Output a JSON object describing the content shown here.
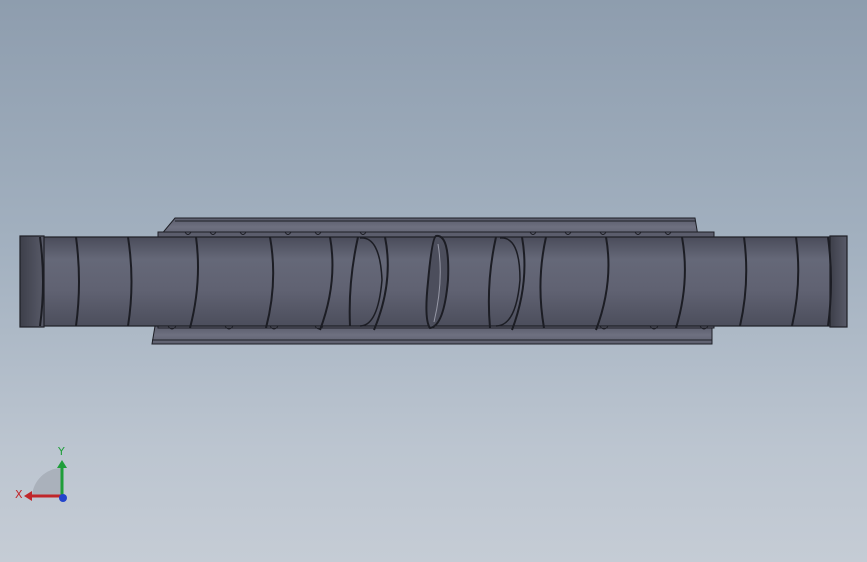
{
  "viewport": {
    "background_top": "#8e9dae",
    "background_bottom": "#c5ccd5"
  },
  "model": {
    "shaft_color": "#5c5e6e",
    "sleeve_color": "#6b6d7d",
    "edge_color": "#1e1f26"
  },
  "triad": {
    "x_label": "X",
    "y_label": "Y",
    "x_color": "#c0262a",
    "y_color": "#1f9e3a",
    "z_color": "#2244cc"
  }
}
